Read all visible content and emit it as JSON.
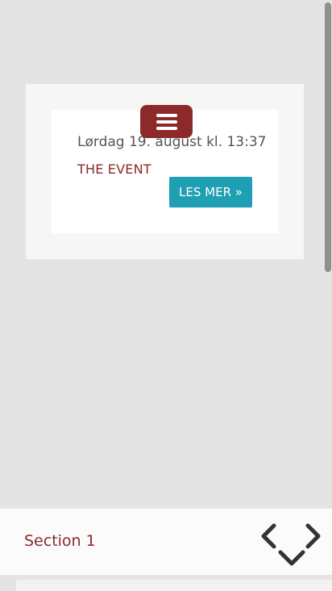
{
  "event": {
    "date": "Lørdag 19. august kl. 13:37",
    "title": "THE EVENT",
    "cta_label": "LES MER »"
  },
  "menu": {
    "icon": "hamburger-icon"
  },
  "section_nav": {
    "label": "Section 1",
    "prev_icon": "chevron-left-icon",
    "next_icon": "chevron-right-icon",
    "down_icon": "chevron-down-icon"
  },
  "colors": {
    "accent_red": "#8c2a2a",
    "button_teal": "#1e9fb3",
    "background": "#e4e4e4"
  }
}
